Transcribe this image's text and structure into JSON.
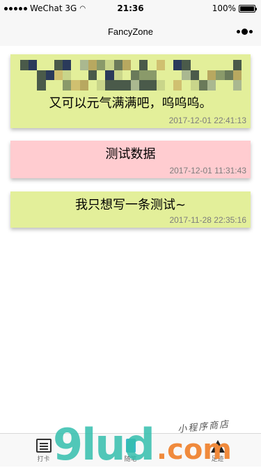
{
  "status_bar": {
    "carrier": "WeChat 3G",
    "time": "21:36",
    "battery": "100%",
    "battery_level": 1.0
  },
  "nav": {
    "title": "FancyZone"
  },
  "cards": [
    {
      "text": "又可以元气满满吧，呜呜呜。",
      "time": "2017-12-01 22:41:13",
      "color": "#e3ef9a"
    },
    {
      "text": "测试数据",
      "time": "2017-12-01 11:31:43",
      "color": "#ffccd0"
    },
    {
      "text": "我只想写一条测试~",
      "time": "2017-11-28 22:35:16",
      "color": "#e3ef9a"
    }
  ],
  "tab_bar": {
    "tabs": [
      {
        "label": "打卡",
        "icon": "checklist-icon"
      },
      {
        "label": "随笔",
        "icon": "note-icon"
      },
      {
        "label": "足迹",
        "icon": "tree-icon"
      }
    ]
  },
  "watermark": {
    "brand": "9lud",
    "domain": ".com",
    "tagline": "小程序商店"
  }
}
